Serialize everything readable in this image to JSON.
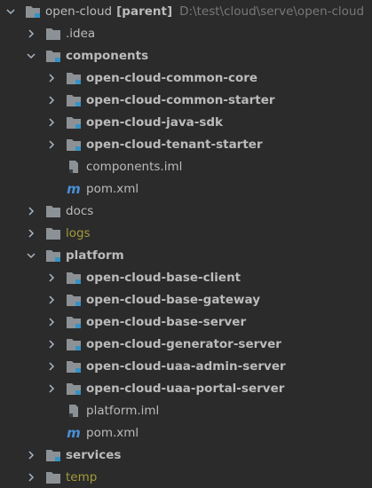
{
  "project": {
    "name": "open-cloud",
    "tag": "[parent]",
    "path": "D:\\test\\cloud\\serve\\open-cloud"
  },
  "tree": [
    {
      "label": ".idea",
      "bold": false,
      "dim": false,
      "expanded": false,
      "icon": "folder-icon"
    },
    {
      "label": "components",
      "bold": true,
      "dim": false,
      "expanded": true,
      "icon": "module-folder-icon"
    },
    {
      "label": "open-cloud-common-core",
      "bold": true,
      "dim": false,
      "expanded": false,
      "icon": "module-folder-icon"
    },
    {
      "label": "open-cloud-common-starter",
      "bold": true,
      "dim": false,
      "expanded": false,
      "icon": "module-folder-icon"
    },
    {
      "label": "open-cloud-java-sdk",
      "bold": true,
      "dim": false,
      "expanded": false,
      "icon": "module-folder-icon"
    },
    {
      "label": "open-cloud-tenant-starter",
      "bold": true,
      "dim": false,
      "expanded": false,
      "icon": "module-folder-icon"
    },
    {
      "label": "components.iml",
      "bold": false,
      "dim": false,
      "expanded": null,
      "icon": "iml-file-icon"
    },
    {
      "label": "pom.xml",
      "bold": false,
      "dim": false,
      "expanded": null,
      "icon": "maven-icon"
    },
    {
      "label": "docs",
      "bold": false,
      "dim": false,
      "expanded": false,
      "icon": "folder-icon"
    },
    {
      "label": "logs",
      "bold": false,
      "dim": true,
      "expanded": false,
      "icon": "folder-icon"
    },
    {
      "label": "platform",
      "bold": true,
      "dim": false,
      "expanded": true,
      "icon": "module-folder-icon"
    },
    {
      "label": "open-cloud-base-client",
      "bold": true,
      "dim": false,
      "expanded": false,
      "icon": "module-folder-icon"
    },
    {
      "label": "open-cloud-base-gateway",
      "bold": true,
      "dim": false,
      "expanded": false,
      "icon": "module-folder-icon"
    },
    {
      "label": "open-cloud-base-server",
      "bold": true,
      "dim": false,
      "expanded": false,
      "icon": "module-folder-icon"
    },
    {
      "label": "open-cloud-generator-server",
      "bold": true,
      "dim": false,
      "expanded": false,
      "icon": "module-folder-icon"
    },
    {
      "label": "open-cloud-uaa-admin-server",
      "bold": true,
      "dim": false,
      "expanded": false,
      "icon": "module-folder-icon"
    },
    {
      "label": "open-cloud-uaa-portal-server",
      "bold": true,
      "dim": false,
      "expanded": false,
      "icon": "module-folder-icon"
    },
    {
      "label": "platform.iml",
      "bold": false,
      "dim": false,
      "expanded": null,
      "icon": "iml-file-icon"
    },
    {
      "label": "pom.xml",
      "bold": false,
      "dim": false,
      "expanded": null,
      "icon": "maven-icon"
    },
    {
      "label": "services",
      "bold": true,
      "dim": false,
      "expanded": false,
      "icon": "module-folder-icon"
    },
    {
      "label": "temp",
      "bold": false,
      "dim": true,
      "expanded": false,
      "icon": "folder-icon"
    }
  ],
  "colors": {
    "background": "#2b2b2b",
    "folder": "#8c9196",
    "module_marker": "#3592c4",
    "excluded_text": "#a39b3b",
    "maven": "#4a8fd6"
  }
}
